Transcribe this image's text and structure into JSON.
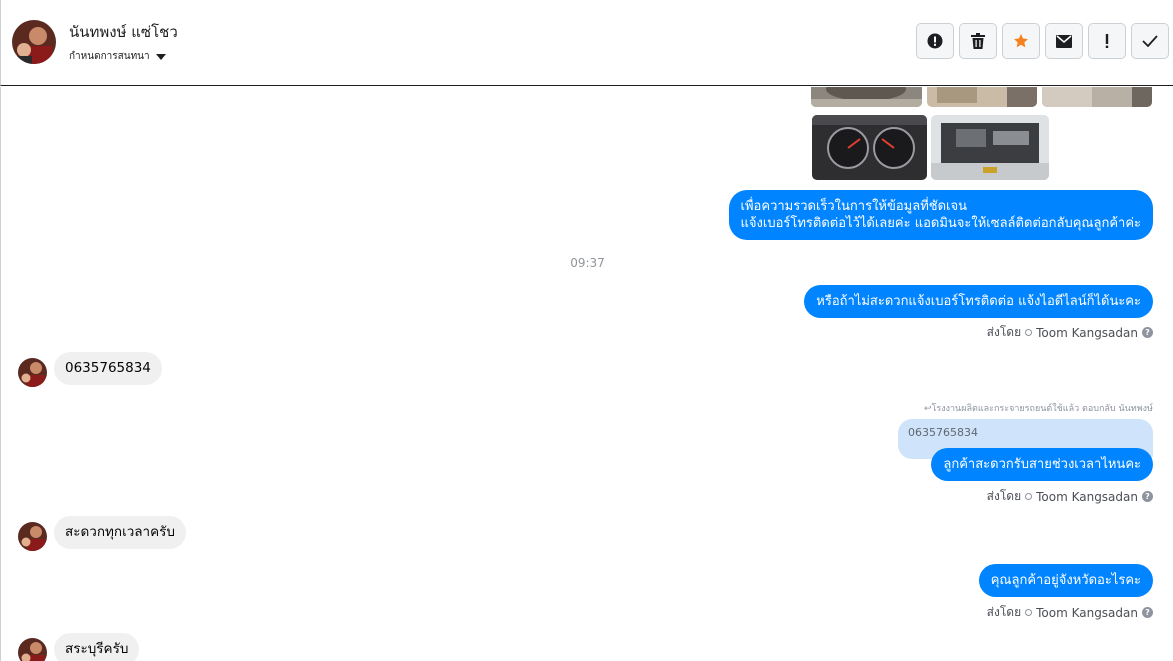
{
  "header": {
    "name": "นันทพงษ์ แซ่โชว",
    "sub_label": "กำหนดการสนทนา"
  },
  "toolbar": {
    "buttons": [
      {
        "icon": "alert-circle-icon",
        "label": "Mark as spam"
      },
      {
        "icon": "trash-icon",
        "label": "Delete"
      },
      {
        "icon": "star-icon",
        "label": "Star"
      },
      {
        "icon": "envelope-icon",
        "label": "Mark as unread"
      },
      {
        "icon": "exclamation-icon",
        "label": "Follow up"
      },
      {
        "icon": "check-icon",
        "label": "Done"
      }
    ]
  },
  "colors": {
    "accent": "#0084ff",
    "star": "#f5821f",
    "incoming_bubble": "#f1f0f0",
    "quote_bubble": "#cfe4fb"
  },
  "messages": {
    "out1_line1": "เพื่อความรวดเร็วในการให้ข้อมูลที่ชัดเจน",
    "out1_line2": "แจ้งเบอร์โทรติดต่อไว้ได้เลยค่ะ แอดมินจะให้เซลล์ติดต่อกลับคุณลูกค้าค่ะ",
    "time": "09:37",
    "out2": "หรือถ้าไม่สะดวกแจ้งเบอร์โทรติดต่อ แจ้งไอดีไลน์ก็ได้นะคะ",
    "sent_by_prefix": "ส่งโดย",
    "sent_by_name": "Toom Kangsadan",
    "in1": "0635765834",
    "reply_note": "↩โรงงานผลิตและกระจายรถยนต์ใช้แล้ว ตอบกลับ นันทพงษ์",
    "reply_quote": "0635765834",
    "out3": "ลูกค้าสะดวกรับสายช่วงเวลาไหนคะ",
    "in2": "สะดวกทุกเวลาครับ",
    "out4": "คุณลูกค้าอยู่จังหวัดอะไรคะ",
    "in3": "สระบุรีครับ"
  }
}
